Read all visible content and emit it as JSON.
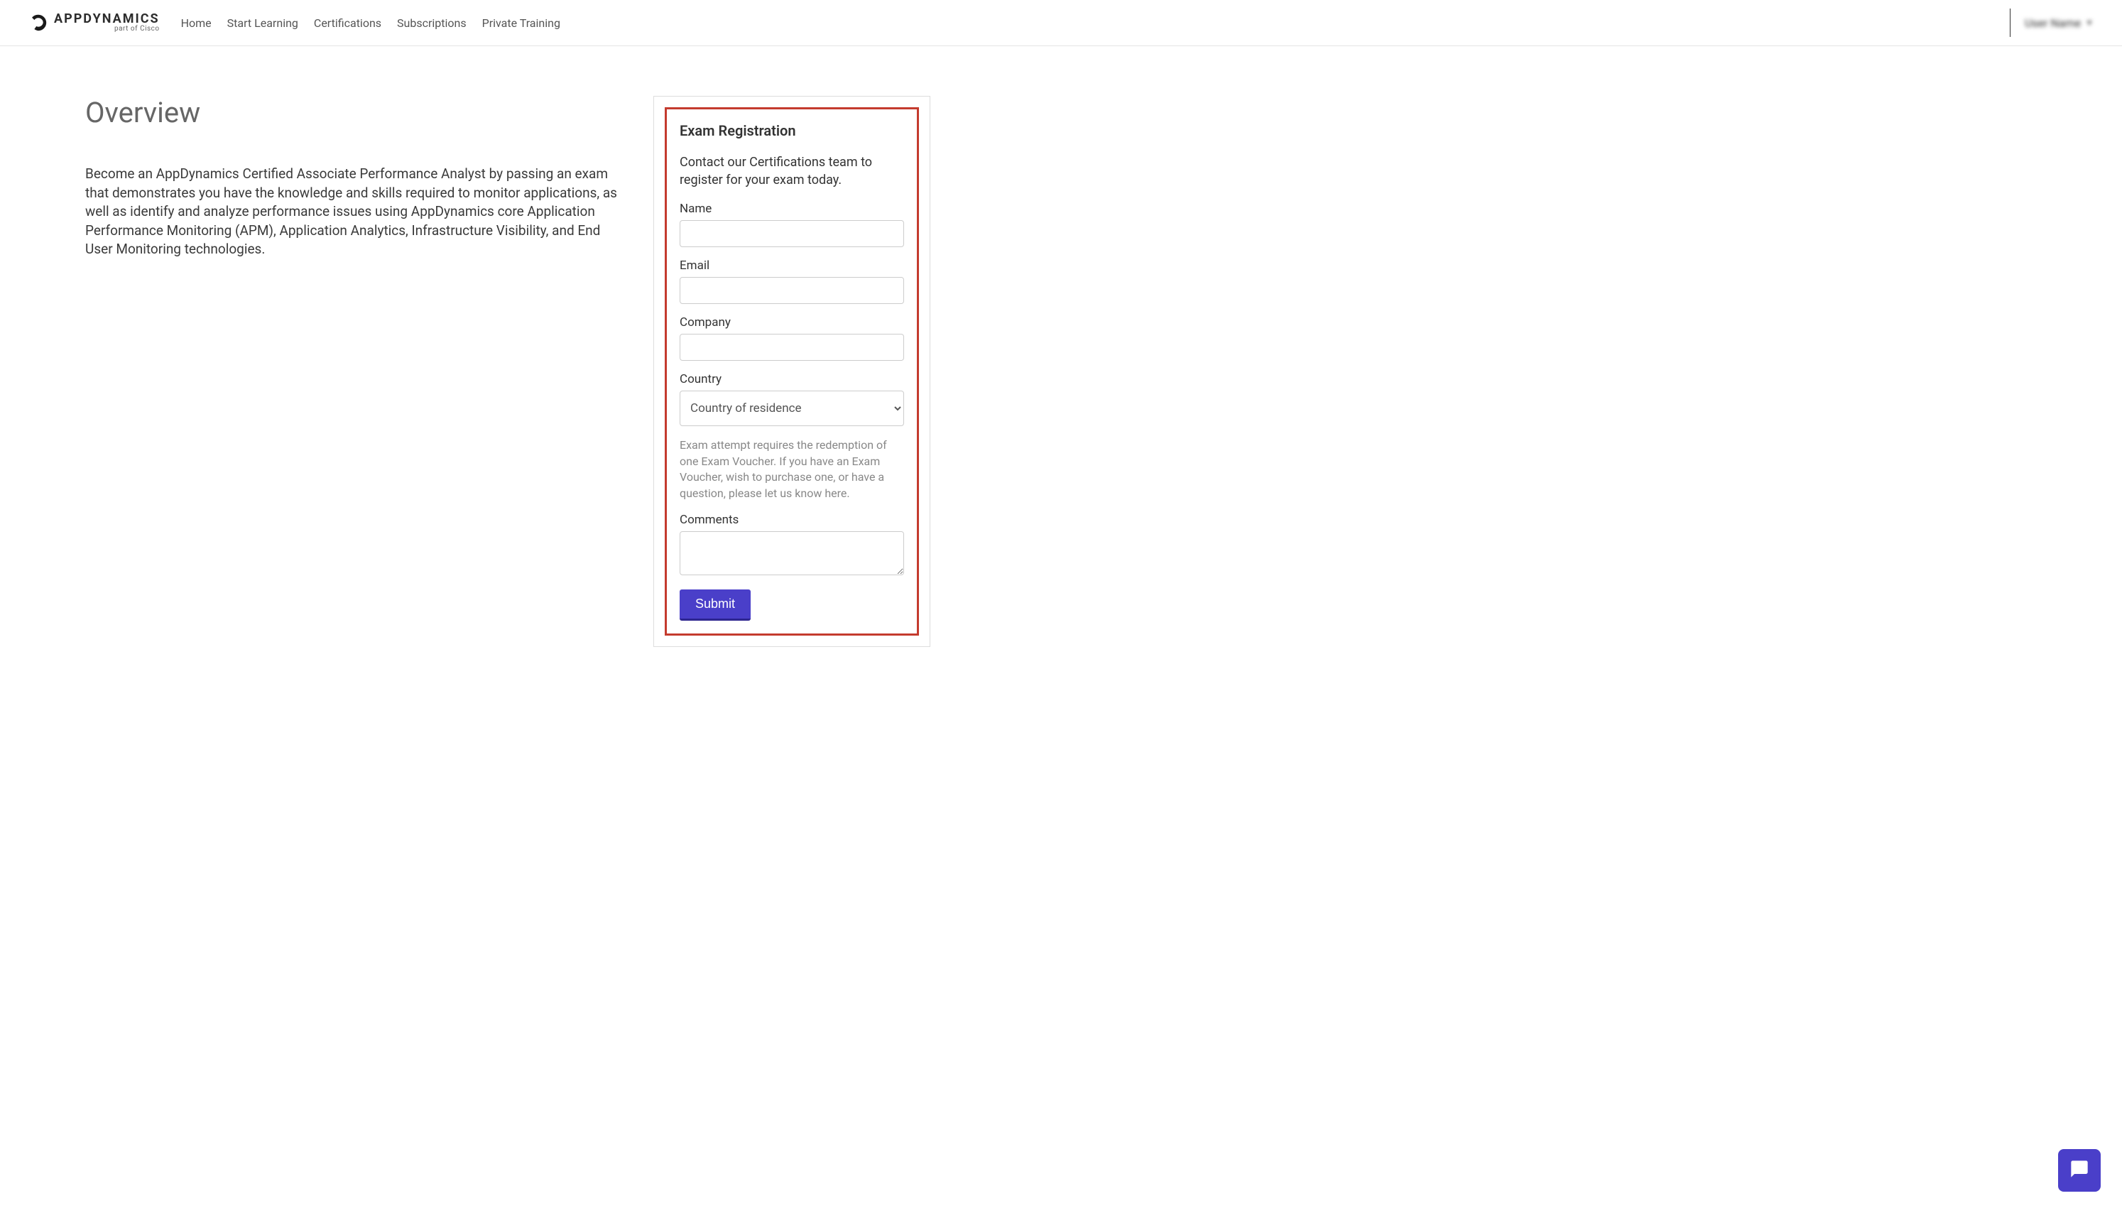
{
  "header": {
    "logo_main": "APPDYNAMICS",
    "logo_sub": "part of Cisco",
    "nav": {
      "home": "Home",
      "start_learning": "Start Learning",
      "certifications": "Certifications",
      "subscriptions": "Subscriptions",
      "private_training": "Private Training"
    },
    "user_name": "User Name"
  },
  "content": {
    "heading": "Overview",
    "body": "Become an AppDynamics Certified Associate Performance Analyst by passing an exam that demonstrates you have the knowledge and skills required to monitor applications, as well as identify and analyze performance issues using AppDynamics core Application Performance Monitoring (APM), Application Analytics, Infrastructure Visibility, and End User Monitoring technologies."
  },
  "form": {
    "title": "Exam Registration",
    "intro": "Contact our Certifications team to register for your exam today.",
    "name_label": "Name",
    "email_label": "Email",
    "company_label": "Company",
    "country_label": "Country",
    "country_placeholder": "Country of residence",
    "help_text": "Exam attempt requires the redemption of one Exam Voucher. If you have an Exam Voucher, wish to purchase one, or have a question, please let us know here.",
    "comments_label": "Comments",
    "submit_label": "Submit"
  }
}
